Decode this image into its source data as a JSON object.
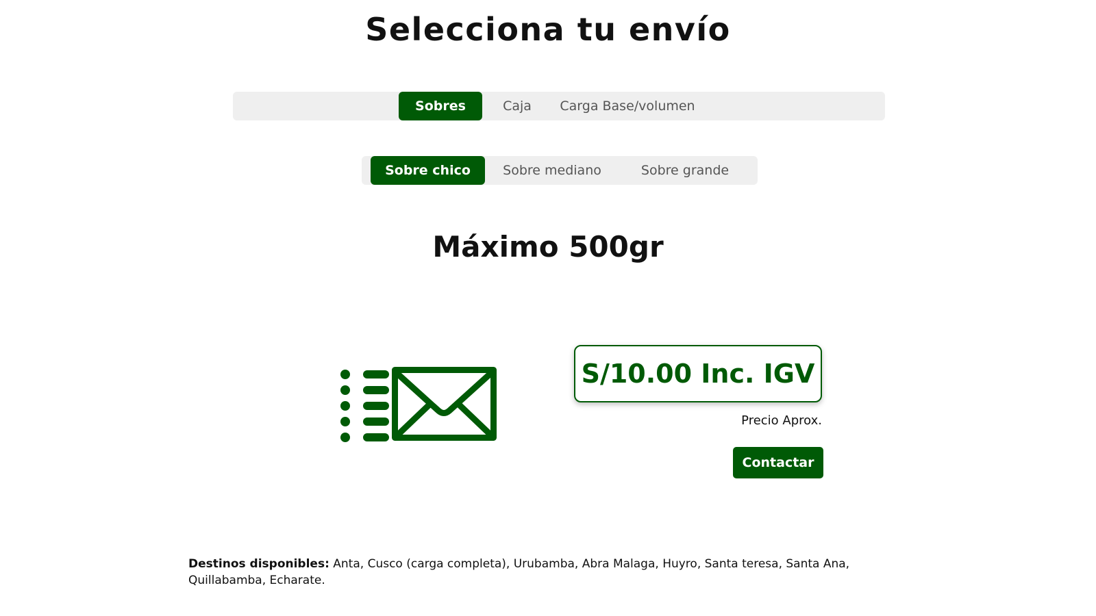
{
  "page": {
    "title": "Selecciona tu envío"
  },
  "main_tabs": [
    {
      "label": "Sobres",
      "active": true
    },
    {
      "label": "Caja",
      "active": false
    },
    {
      "label": "Carga Base/volumen",
      "active": false
    }
  ],
  "sub_tabs": [
    {
      "label": "Sobre chico",
      "active": true
    },
    {
      "label": "Sobre mediano",
      "active": false
    },
    {
      "label": "Sobre grande",
      "active": false
    }
  ],
  "option": {
    "heading": "Máximo 500gr",
    "icon": "envelope-fast-icon",
    "price": "S/10.00 Inc. IGV",
    "price_note": "Precio Aprox.",
    "contact_label": "Contactar"
  },
  "destinos": {
    "label": "Destinos disponibles:",
    "text": " Anta, Cusco (carga completa), Urubamba, Abra Malaga, Huyro, Santa teresa, Santa Ana, Quillabamba, Echarate."
  },
  "colors": {
    "accent": "#005a06",
    "tab_bg": "#efefef",
    "inactive_text": "#555555"
  }
}
